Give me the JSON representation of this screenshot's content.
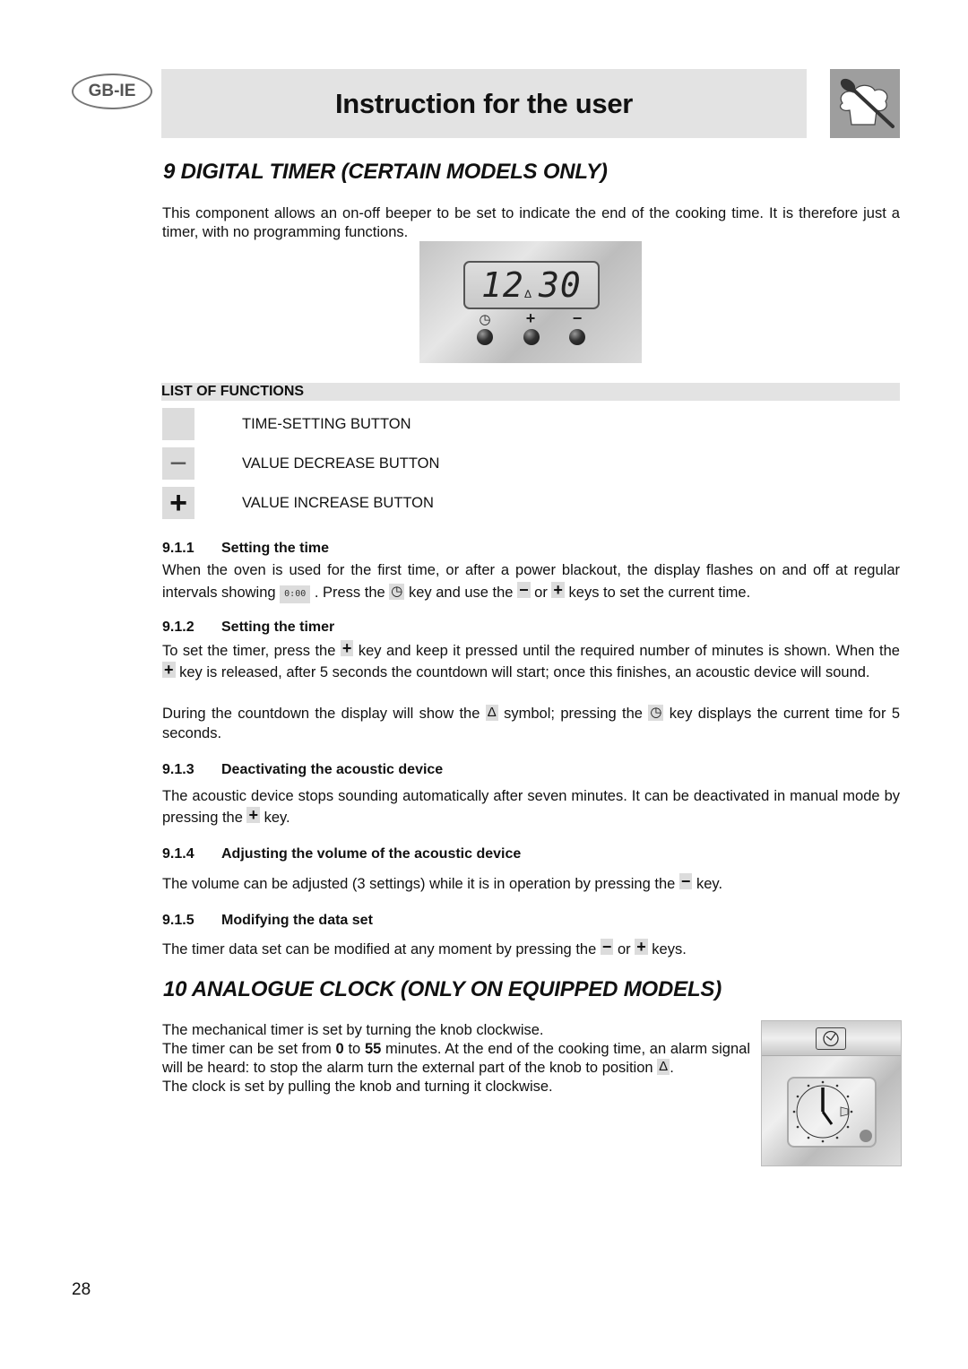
{
  "header": {
    "badge": "GB-IE",
    "title": "Instruction for the user",
    "logo_icon": "chef-hat-spoon-icon"
  },
  "section9": {
    "title": "9   DIGITAL TIMER (CERTAIN MODELS ONLY)",
    "intro": "This component allows an on-off beeper to be set to indicate the end of the cooking time.  It is therefore just a timer, with no programming functions.",
    "display": {
      "hours": "12",
      "minutes": "30",
      "bell_symbol": "Δ",
      "buttons": [
        {
          "icon": "clock-icon",
          "glyph": "◷"
        },
        {
          "icon": "plus-icon",
          "glyph": "+"
        },
        {
          "icon": "minus-icon",
          "glyph": "−"
        }
      ]
    },
    "list_of_functions": {
      "title": "LIST OF FUNCTIONS",
      "items": [
        {
          "icon": "time-setting-icon",
          "glyph": "",
          "label": "TIME-SETTING BUTTON"
        },
        {
          "icon": "value-decrease-icon",
          "glyph": "−",
          "label": "VALUE DECREASE BUTTON"
        },
        {
          "icon": "value-increase-icon",
          "glyph": "+",
          "label": "VALUE INCREASE BUTTON"
        }
      ]
    },
    "subsections": {
      "s1": {
        "num": "9.1.1",
        "title": "Setting the time",
        "t1": "When the oven is used for the first time, or after a power blackout, the display flashes on and off at regular intervals showing ",
        "display_value": "0:00",
        "t2": " . Press the ",
        "t3": " key and use the ",
        "t4": " or ",
        "t5": " keys to set the current time."
      },
      "s2": {
        "num": "9.1.2",
        "title": "Setting the timer",
        "t1": "To set the timer, press the ",
        "t2": " key and keep it pressed until the required number of minutes is shown. When the ",
        "t3": " key is released, after 5 seconds the countdown will start; once this finishes, an acoustic device will sound.",
        "t4": "During the countdown the display will show the ",
        "t5": " symbol; pressing the ",
        "t6": " key displays the current time for 5 seconds."
      },
      "s3": {
        "num": "9.1.3",
        "title": "Deactivating the acoustic device",
        "t1": "The acoustic device stops sounding automatically after seven minutes.  It can be deactivated in manual mode by pressing the ",
        "t2": " key."
      },
      "s4": {
        "num": "9.1.4",
        "title": "Adjusting the volume of the acoustic device",
        "t1": "The volume can be adjusted (3 settings) while it is in operation by pressing the ",
        "t2": " key."
      },
      "s5": {
        "num": "9.1.5",
        "title": "Modifying the data set",
        "t1": "The timer data set can be modified at any moment by pressing the ",
        "t2": " or ",
        "t3": " keys."
      }
    }
  },
  "section10": {
    "title": "10  ANALOGUE CLOCK (ONLY ON EQUIPPED MODELS)",
    "p1": "The mechanical timer is set by turning the knob clockwise.",
    "p2a": "The timer can be set from ",
    "p2_min": "0",
    "p2b": " to ",
    "p2_max": "55",
    "p2c": " minutes. At the end of the cooking time, an alarm signal will be heard: to stop the alarm turn the external part of the knob to position ",
    "p2d": ".",
    "p3": "The clock is set by pulling the knob and turning it clockwise."
  },
  "keys": {
    "plus": "+",
    "minus": "−",
    "clock": "◷",
    "bell": "Δ"
  },
  "page_number": "28"
}
